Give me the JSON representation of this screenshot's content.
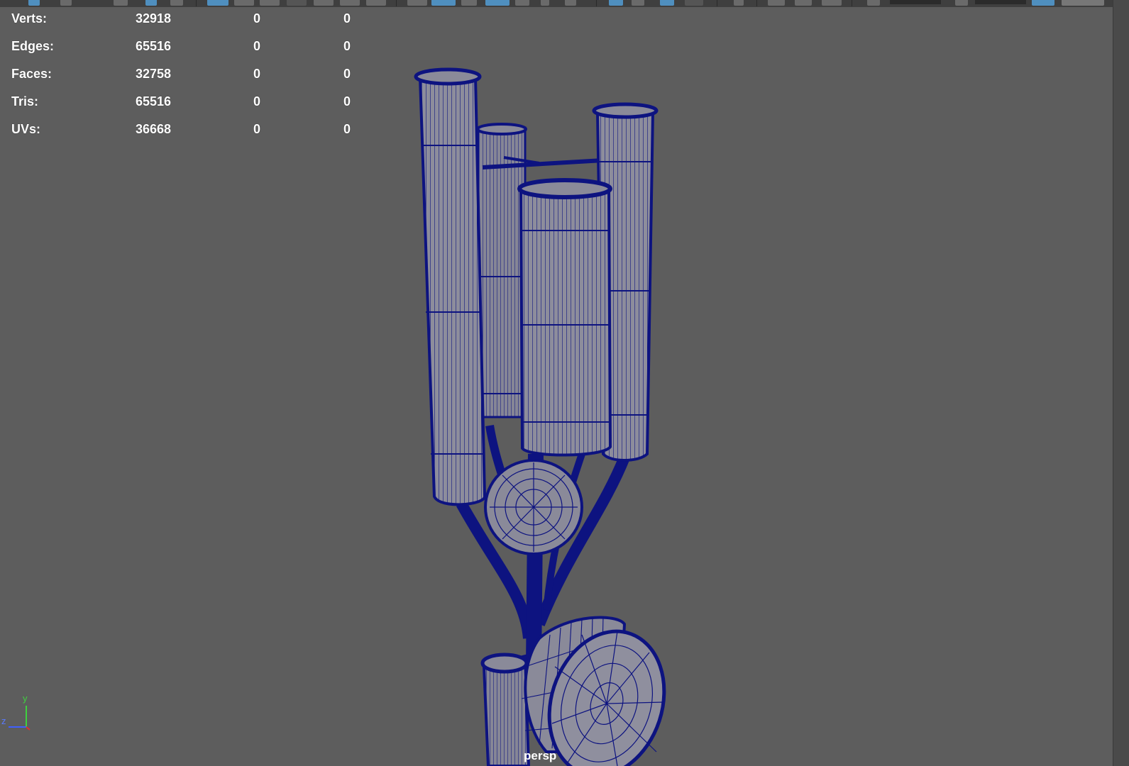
{
  "hud": {
    "rows": [
      {
        "label": "Verts:",
        "c1": "32918",
        "c2": "0",
        "c3": "0"
      },
      {
        "label": "Edges:",
        "c1": "65516",
        "c2": "0",
        "c3": "0"
      },
      {
        "label": "Faces:",
        "c1": "32758",
        "c2": "0",
        "c3": "0"
      },
      {
        "label": "Tris:",
        "c1": "65516",
        "c2": "0",
        "c3": "0"
      },
      {
        "label": "UVs:",
        "c1": "36668",
        "c2": "0",
        "c3": "0"
      }
    ]
  },
  "viewport": {
    "camera": "persp",
    "axes": {
      "y": "y",
      "z": "z"
    },
    "wireframe_color": "#0d1380",
    "surface_color": "#8a8a99",
    "background_color": "#5d5d5d"
  }
}
